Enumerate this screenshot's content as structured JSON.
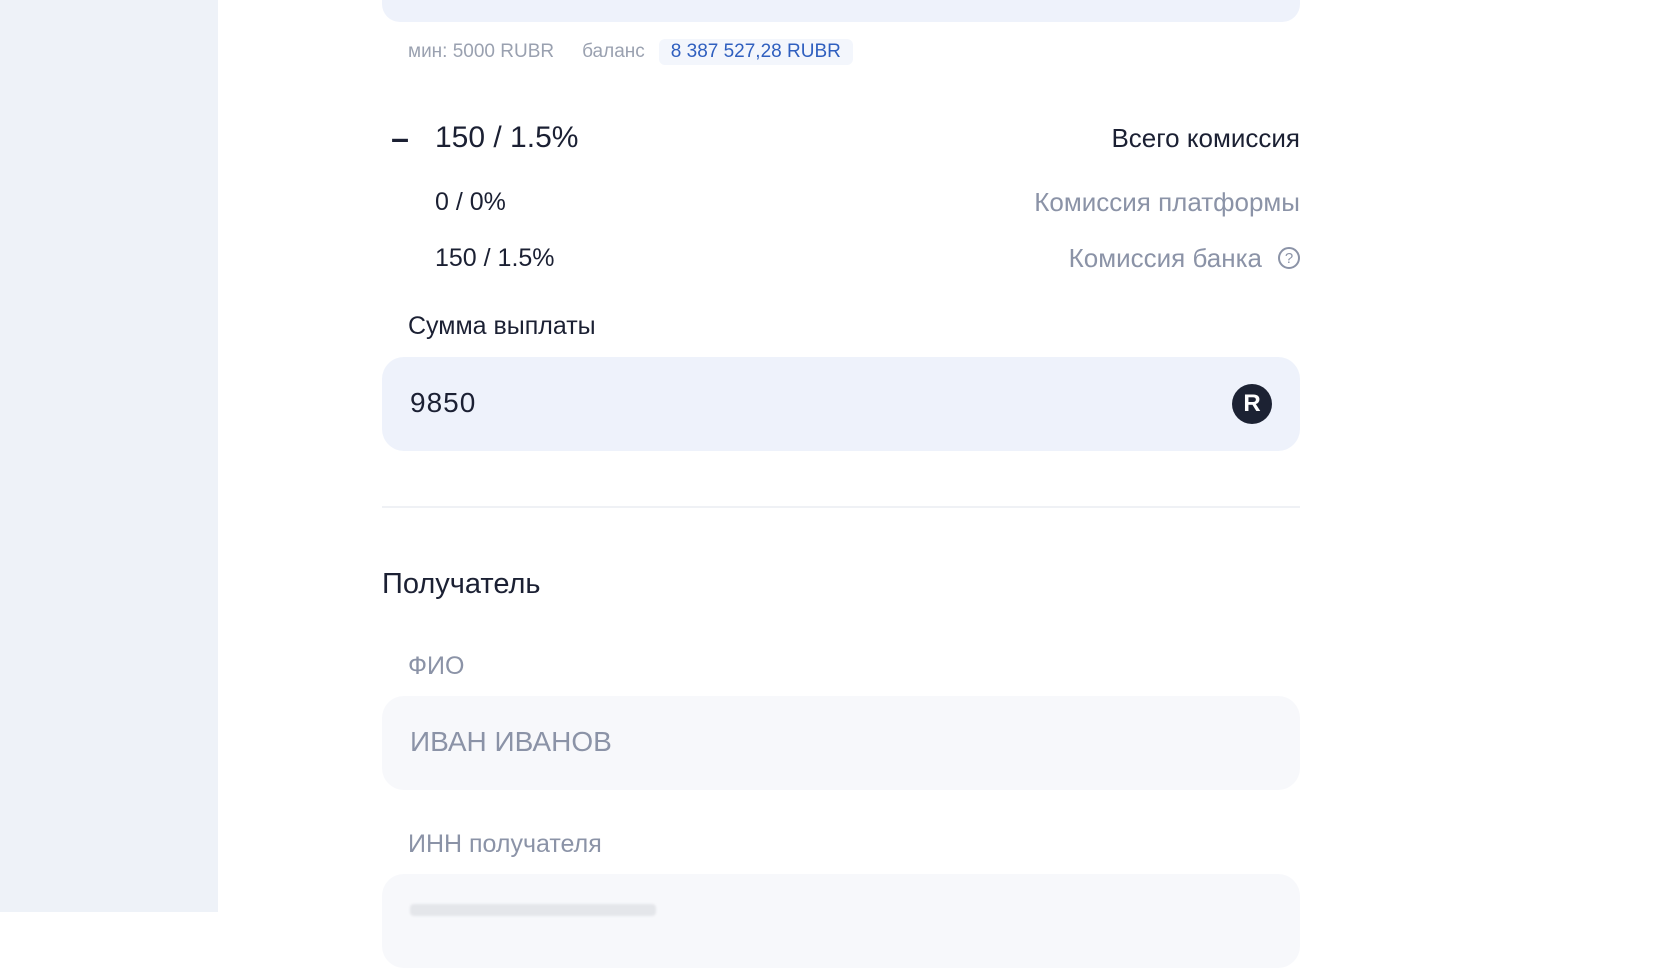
{
  "limits": {
    "min": "мин: 5000 RUBR",
    "balance_label": "баланс",
    "balance_value": "8 387 527,28 RUBR"
  },
  "commission": {
    "toggle_symbol": "–",
    "total_value": "150 / 1.5%",
    "total_label": "Всего комиссия",
    "platform_value": "0 / 0%",
    "platform_label": "Комиссия платформы",
    "bank_value": "150  / 1.5%",
    "bank_label": "Комиссия банка",
    "help_symbol": "?"
  },
  "payout": {
    "label": "Сумма выплаты",
    "value": "9850",
    "currency_symbol": "R"
  },
  "recipient": {
    "title": "Получатель",
    "fio_label": "ФИО",
    "fio_value": "ИВАН ИВАНОВ",
    "inn_label": "ИНН получателя"
  },
  "colors": {
    "sidebar": "#eef2f8",
    "field_bg": "#eef2fb",
    "accent": "#2f5fbf",
    "muted": "#8b93a7"
  }
}
